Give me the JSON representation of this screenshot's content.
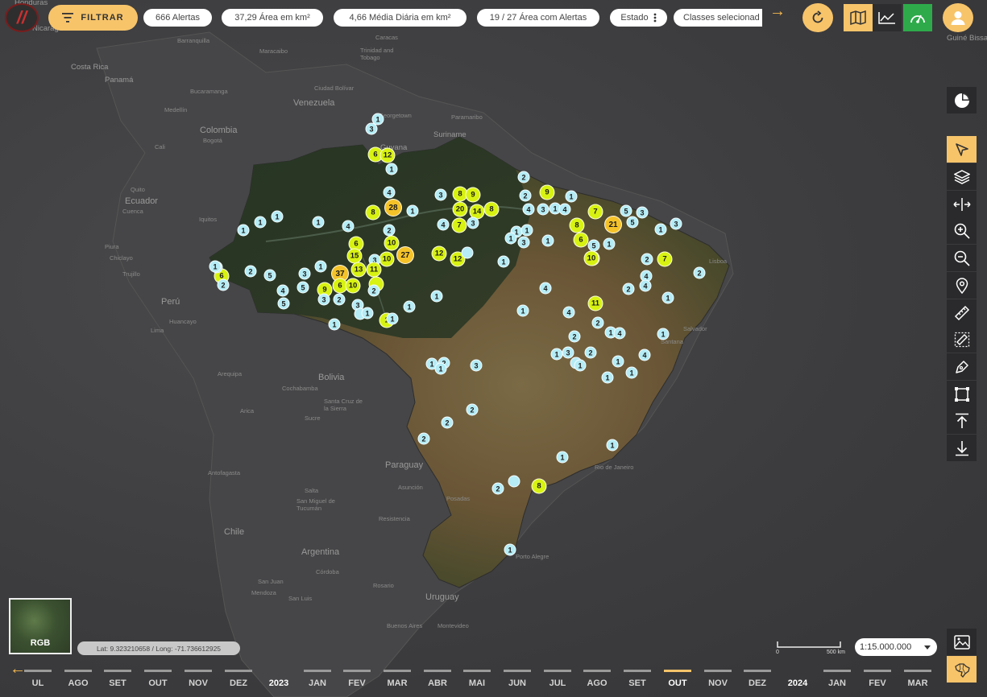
{
  "logo": {
    "glyph": "//"
  },
  "filter": {
    "label": "FILTRAR"
  },
  "stats": {
    "alerts": "666 Alertas",
    "area": "37,29 Área em km²",
    "daily_avg": "4,66 Média Diária em km²",
    "area_with_alerts": "19 / 27 Área com Alertas",
    "state": "Estado",
    "classes": "Classes selecionad"
  },
  "colors": {
    "accent": "#f7c46a",
    "green_btn": "#2eaa4b",
    "marker_small": "#b5ecf5",
    "marker_medium": "#d8f212",
    "marker_large": "#f5c329"
  },
  "countries": [
    {
      "name": "Honduras"
    },
    {
      "name": "Nicaragua"
    },
    {
      "name": "Costa Rica"
    },
    {
      "name": "Panamá"
    },
    {
      "name": "Colombia"
    },
    {
      "name": "Venezuela"
    },
    {
      "name": "Ecuador"
    },
    {
      "name": "Perú"
    },
    {
      "name": "Bolivia"
    },
    {
      "name": "Paraguay"
    },
    {
      "name": "Chile"
    },
    {
      "name": "Argentina"
    },
    {
      "name": "Uruguay"
    },
    {
      "name": "Guyana"
    },
    {
      "name": "Suriname"
    },
    {
      "name": "Guiné Bissau"
    }
  ],
  "cities": [
    {
      "name": "Caracas"
    },
    {
      "name": "Barranquilla"
    },
    {
      "name": "Maracaibo"
    },
    {
      "name": "Trinidad and Tobago"
    },
    {
      "name": "Bucaramanga"
    },
    {
      "name": "Medellín"
    },
    {
      "name": "Bogotá"
    },
    {
      "name": "Cali"
    },
    {
      "name": "Quito"
    },
    {
      "name": "Cuenca"
    },
    {
      "name": "Iquitos"
    },
    {
      "name": "Piura"
    },
    {
      "name": "Chiclayo"
    },
    {
      "name": "Trujillo"
    },
    {
      "name": "Lima"
    },
    {
      "name": "Huancayo"
    },
    {
      "name": "Arequipa"
    },
    {
      "name": "Cochabamba"
    },
    {
      "name": "Santa Cruz de la Sierra"
    },
    {
      "name": "Sucre"
    },
    {
      "name": "Arica"
    },
    {
      "name": "Antofagasta"
    },
    {
      "name": "Salta"
    },
    {
      "name": "San Miguel de Tucumán"
    },
    {
      "name": "Asunción"
    },
    {
      "name": "Resistencia"
    },
    {
      "name": "Posadas"
    },
    {
      "name": "Córdoba"
    },
    {
      "name": "Rosario"
    },
    {
      "name": "San Juan"
    },
    {
      "name": "Mendoza"
    },
    {
      "name": "San Luis"
    },
    {
      "name": "Buenos Aires"
    },
    {
      "name": "Montevideo"
    },
    {
      "name": "Paramaribo"
    },
    {
      "name": "Georgetown"
    },
    {
      "name": "Ciudad Bolívar"
    },
    {
      "name": "Rio de Janeiro"
    },
    {
      "name": "Porto Alegre"
    },
    {
      "name": "Lisboa"
    },
    {
      "name": "Salvador"
    },
    {
      "name": "Santana"
    }
  ],
  "markers": [
    {
      "v": "1",
      "s": "s"
    },
    {
      "v": "3",
      "s": "s"
    },
    {
      "v": "6",
      "s": "m"
    },
    {
      "v": "12",
      "s": "m"
    },
    {
      "v": "1",
      "s": "s"
    },
    {
      "v": "4",
      "s": "s"
    },
    {
      "v": "3",
      "s": "s"
    },
    {
      "v": "8",
      "s": "m"
    },
    {
      "v": "9",
      "s": "m"
    },
    {
      "v": "9",
      "s": "m"
    },
    {
      "v": "2",
      "s": "s"
    },
    {
      "v": "2",
      "s": "s"
    },
    {
      "v": "1",
      "s": "s"
    },
    {
      "v": "28",
      "s": "l"
    },
    {
      "v": "1",
      "s": "s"
    },
    {
      "v": "8",
      "s": "m"
    },
    {
      "v": "20",
      "s": "m"
    },
    {
      "v": "14",
      "s": "m"
    },
    {
      "v": "8",
      "s": "m"
    },
    {
      "v": "4",
      "s": "s"
    },
    {
      "v": "3",
      "s": "s"
    },
    {
      "v": "1",
      "s": "s"
    },
    {
      "v": "4",
      "s": "s"
    },
    {
      "v": "7",
      "s": "m"
    },
    {
      "v": "5",
      "s": "s"
    },
    {
      "v": "3",
      "s": "s"
    },
    {
      "v": "21",
      "s": "l"
    },
    {
      "v": "5",
      "s": "s"
    },
    {
      "v": "3",
      "s": "s"
    },
    {
      "v": "1",
      "s": "s"
    },
    {
      "v": "1",
      "s": "s"
    },
    {
      "v": "1",
      "s": "s"
    },
    {
      "v": "1",
      "s": "s"
    },
    {
      "v": "1",
      "s": "s"
    },
    {
      "v": "4",
      "s": "s"
    },
    {
      "v": "7",
      "s": "m"
    },
    {
      "v": "3",
      "s": "s"
    },
    {
      "v": "4",
      "s": "s"
    },
    {
      "v": "2",
      "s": "s"
    },
    {
      "v": "8",
      "s": "m"
    },
    {
      "v": "6",
      "s": "m"
    },
    {
      "v": "1",
      "s": "s"
    },
    {
      "v": "5",
      "s": "s"
    },
    {
      "v": "1",
      "s": "s"
    },
    {
      "v": "1",
      "s": "s"
    },
    {
      "v": "3",
      "s": "s"
    },
    {
      "v": "1",
      "s": "s"
    },
    {
      "v": "10",
      "s": "m"
    },
    {
      "v": "6",
      "s": "m"
    },
    {
      "v": "10",
      "s": "m"
    },
    {
      "v": "15",
      "s": "m"
    },
    {
      "v": "10",
      "s": "m"
    },
    {
      "v": "27",
      "s": "l"
    },
    {
      "v": "12",
      "s": "m"
    },
    {
      "v": "12",
      "s": "m"
    },
    {
      "v": "",
      "s": "s"
    },
    {
      "v": "3",
      "s": "s"
    },
    {
      "v": "13",
      "s": "m"
    },
    {
      "v": "11",
      "s": "m"
    },
    {
      "v": "1",
      "s": "s"
    },
    {
      "v": "1",
      "s": "s"
    },
    {
      "v": "6",
      "s": "m"
    },
    {
      "v": "2",
      "s": "s"
    },
    {
      "v": "5",
      "s": "s"
    },
    {
      "v": "5",
      "s": "s"
    },
    {
      "v": "3",
      "s": "s"
    },
    {
      "v": "1",
      "s": "s"
    },
    {
      "v": "37",
      "s": "l"
    },
    {
      "v": "9",
      "s": "m"
    },
    {
      "v": "6",
      "s": "m"
    },
    {
      "v": "10",
      "s": "m"
    },
    {
      "v": "",
      "s": "m"
    },
    {
      "v": "4",
      "s": "s"
    },
    {
      "v": "5",
      "s": "s"
    },
    {
      "v": "2",
      "s": "s"
    },
    {
      "v": "3",
      "s": "s"
    },
    {
      "v": "2",
      "s": "s"
    },
    {
      "v": "3",
      "s": "s"
    },
    {
      "v": "2",
      "s": "s"
    },
    {
      "v": "",
      "s": "s"
    },
    {
      "v": "1",
      "s": "s"
    },
    {
      "v": "1",
      "s": "m"
    },
    {
      "v": "1",
      "s": "s"
    },
    {
      "v": "1",
      "s": "s"
    },
    {
      "v": "1",
      "s": "s"
    },
    {
      "v": "1",
      "s": "s"
    },
    {
      "v": "4",
      "s": "s"
    },
    {
      "v": "2",
      "s": "s"
    },
    {
      "v": "10",
      "s": "m"
    },
    {
      "v": "7",
      "s": "m"
    },
    {
      "v": "2",
      "s": "s"
    },
    {
      "v": "4",
      "s": "s"
    },
    {
      "v": "4",
      "s": "s"
    },
    {
      "v": "2",
      "s": "s"
    },
    {
      "v": "1",
      "s": "s"
    },
    {
      "v": "11",
      "s": "m"
    },
    {
      "v": "1",
      "s": "s"
    },
    {
      "v": "4",
      "s": "s"
    },
    {
      "v": "2",
      "s": "s"
    },
    {
      "v": "2",
      "s": "s"
    },
    {
      "v": "1",
      "s": "s"
    },
    {
      "v": "4",
      "s": "s"
    },
    {
      "v": "1",
      "s": "s"
    },
    {
      "v": "1",
      "s": "s"
    },
    {
      "v": "3",
      "s": "s"
    },
    {
      "v": "2",
      "s": "s"
    },
    {
      "v": "",
      "s": "s"
    },
    {
      "v": "1",
      "s": "s"
    },
    {
      "v": "1",
      "s": "s"
    },
    {
      "v": "4",
      "s": "s"
    },
    {
      "v": "1",
      "s": "s"
    },
    {
      "v": "1",
      "s": "s"
    },
    {
      "v": "1",
      "s": "s"
    },
    {
      "v": "2",
      "s": "s"
    },
    {
      "v": "3",
      "s": "s"
    },
    {
      "v": "1",
      "s": "s"
    },
    {
      "v": "2",
      "s": "s"
    },
    {
      "v": "2",
      "s": "s"
    },
    {
      "v": "2",
      "s": "s"
    },
    {
      "v": "1",
      "s": "s"
    },
    {
      "v": "1",
      "s": "s"
    },
    {
      "v": "2",
      "s": "s"
    },
    {
      "v": "",
      "s": "s"
    },
    {
      "v": "8",
      "s": "m"
    },
    {
      "v": "1",
      "s": "s"
    },
    {
      "v": "1",
      "s": "s"
    },
    {
      "v": "1",
      "s": "s"
    }
  ],
  "thumb": {
    "label": "RGB"
  },
  "coords": {
    "text": "Lat: 9.323210658 / Long: -71.736612925"
  },
  "scale": {
    "value": "1:15.000.000",
    "bar_start": "0",
    "bar_end": "500 km"
  },
  "timeline": {
    "back_label": "←",
    "items": [
      {
        "label": "UL"
      },
      {
        "label": "AGO"
      },
      {
        "label": "SET"
      },
      {
        "label": "OUT"
      },
      {
        "label": "NOV"
      },
      {
        "label": "DEZ"
      },
      {
        "label": "2023",
        "year": true
      },
      {
        "label": "JAN"
      },
      {
        "label": "FEV"
      },
      {
        "label": "MAR"
      },
      {
        "label": "ABR"
      },
      {
        "label": "MAI"
      },
      {
        "label": "JUN"
      },
      {
        "label": "JUL"
      },
      {
        "label": "AGO"
      },
      {
        "label": "SET"
      },
      {
        "label": "OUT",
        "active": true
      },
      {
        "label": "NOV"
      },
      {
        "label": "DEZ"
      },
      {
        "label": "2024",
        "year": true
      },
      {
        "label": "JAN"
      },
      {
        "label": "FEV"
      },
      {
        "label": "MAR"
      }
    ]
  }
}
